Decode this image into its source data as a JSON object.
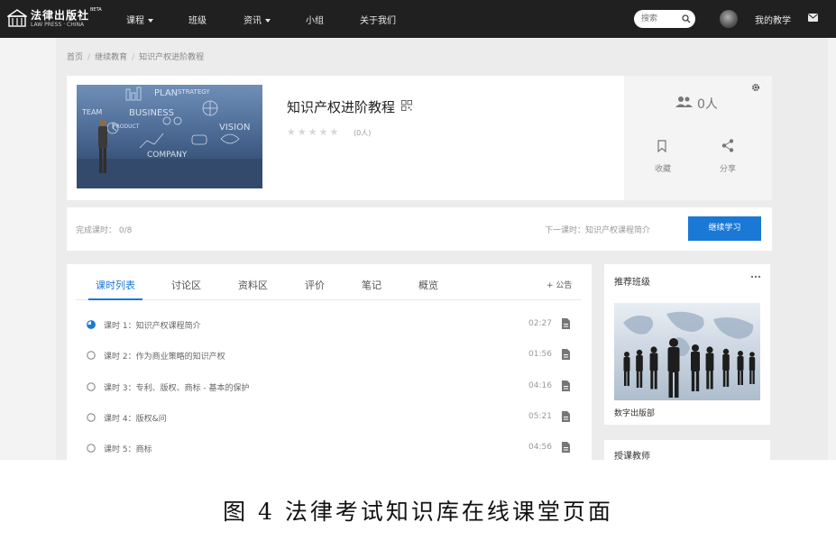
{
  "nav": {
    "brand_cn": "法律出版社",
    "brand_beta": "BETA",
    "brand_en": "LAW PRESS · CHINA",
    "items": [
      {
        "label": "课程",
        "dropdown": true
      },
      {
        "label": "班级",
        "dropdown": false
      },
      {
        "label": "资讯",
        "dropdown": true
      },
      {
        "label": "小组",
        "dropdown": false
      },
      {
        "label": "关于我们",
        "dropdown": false
      }
    ],
    "search_placeholder": "搜索",
    "my_study": "我的教学"
  },
  "breadcrumb": [
    "首页",
    "继续教育",
    "知识产权进阶教程"
  ],
  "course": {
    "title": "知识产权进阶教程",
    "stars": "★★★★★",
    "rating_count": "(0人)",
    "people_count": "0人",
    "favorite": "收藏",
    "share": "分享"
  },
  "progress": {
    "done": "完成课时： 0/8",
    "next": "下一课时：知识产权课程简介",
    "continue": "继续学习"
  },
  "tabs": [
    "课时列表",
    "讨论区",
    "资料区",
    "评价",
    "笔记",
    "概览"
  ],
  "notice": "+ 公告",
  "lessons": [
    {
      "title": "课时 1：知识产权课程简介",
      "duration": "02:27",
      "current": true
    },
    {
      "title": "课时 2：作为商业策略的知识产权",
      "duration": "01:56",
      "current": false
    },
    {
      "title": "课时 3：专利、版权、商标 - 基本的保护",
      "duration": "04:16",
      "current": false
    },
    {
      "title": "课时 4：版权&问",
      "duration": "05:21",
      "current": false
    },
    {
      "title": "课时 5：商标",
      "duration": "04:56",
      "current": false
    }
  ],
  "recommend": {
    "title": "推荐班级",
    "class_name": "数字出版部"
  },
  "teacher_title": "授课教师",
  "caption": "图 4 法律考试知识库在线课堂页面",
  "colors": {
    "nav_bg": "#202020",
    "accent": "#1a78d6",
    "page_bg": "#f3f3f3"
  }
}
